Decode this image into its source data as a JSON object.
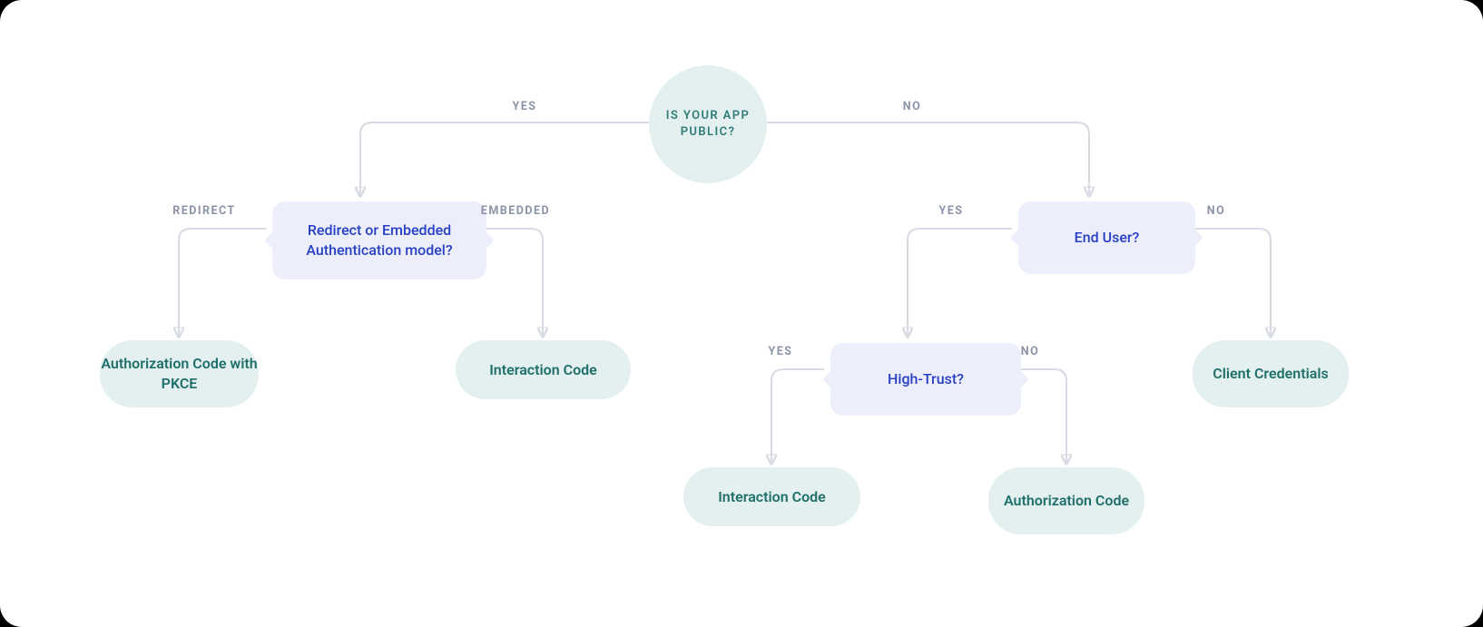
{
  "root": {
    "label": "IS YOUR APP PUBLIC?",
    "edge_yes": "YES",
    "edge_no": "NO"
  },
  "left": {
    "decision": "Redirect or Embedded Authentication model?",
    "edge_redirect": "REDIRECT",
    "edge_embedded": "EMBEDDED",
    "result_redirect": "Authorization Code with PKCE",
    "result_embedded": "Interaction Code"
  },
  "right": {
    "decision_enduser": "End User?",
    "edge_yes": "YES",
    "edge_no": "NO",
    "result_no_enduser": "Client Credentials",
    "decision_hightrust": "High-Trust?",
    "ht_edge_yes": "YES",
    "ht_edge_no": "NO",
    "result_ht_yes": "Interaction Code",
    "result_ht_no": "Authorization Code"
  }
}
